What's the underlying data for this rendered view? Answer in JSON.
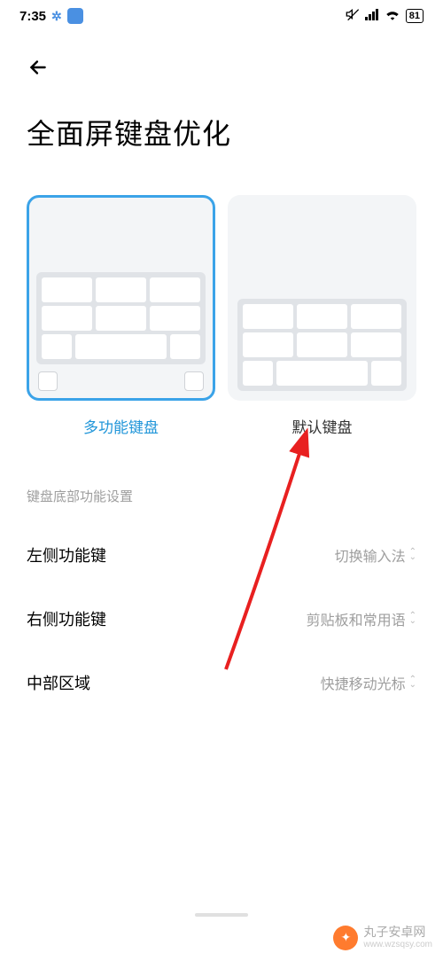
{
  "status_bar": {
    "time": "7:35",
    "battery": "81"
  },
  "header": {
    "page_title": "全面屏键盘优化"
  },
  "options": [
    {
      "label": "多功能键盘",
      "selected": true,
      "shows_corners": true
    },
    {
      "label": "默认键盘",
      "selected": false,
      "shows_corners": false
    }
  ],
  "section_header": "键盘底部功能设置",
  "settings": [
    {
      "label": "左侧功能键",
      "value": "切换输入法"
    },
    {
      "label": "右侧功能键",
      "value": "剪贴板和常用语"
    },
    {
      "label": "中部区域",
      "value": "快捷移动光标"
    }
  ],
  "watermark": {
    "name": "丸子安卓网",
    "url": "www.wzsqsy.com"
  }
}
